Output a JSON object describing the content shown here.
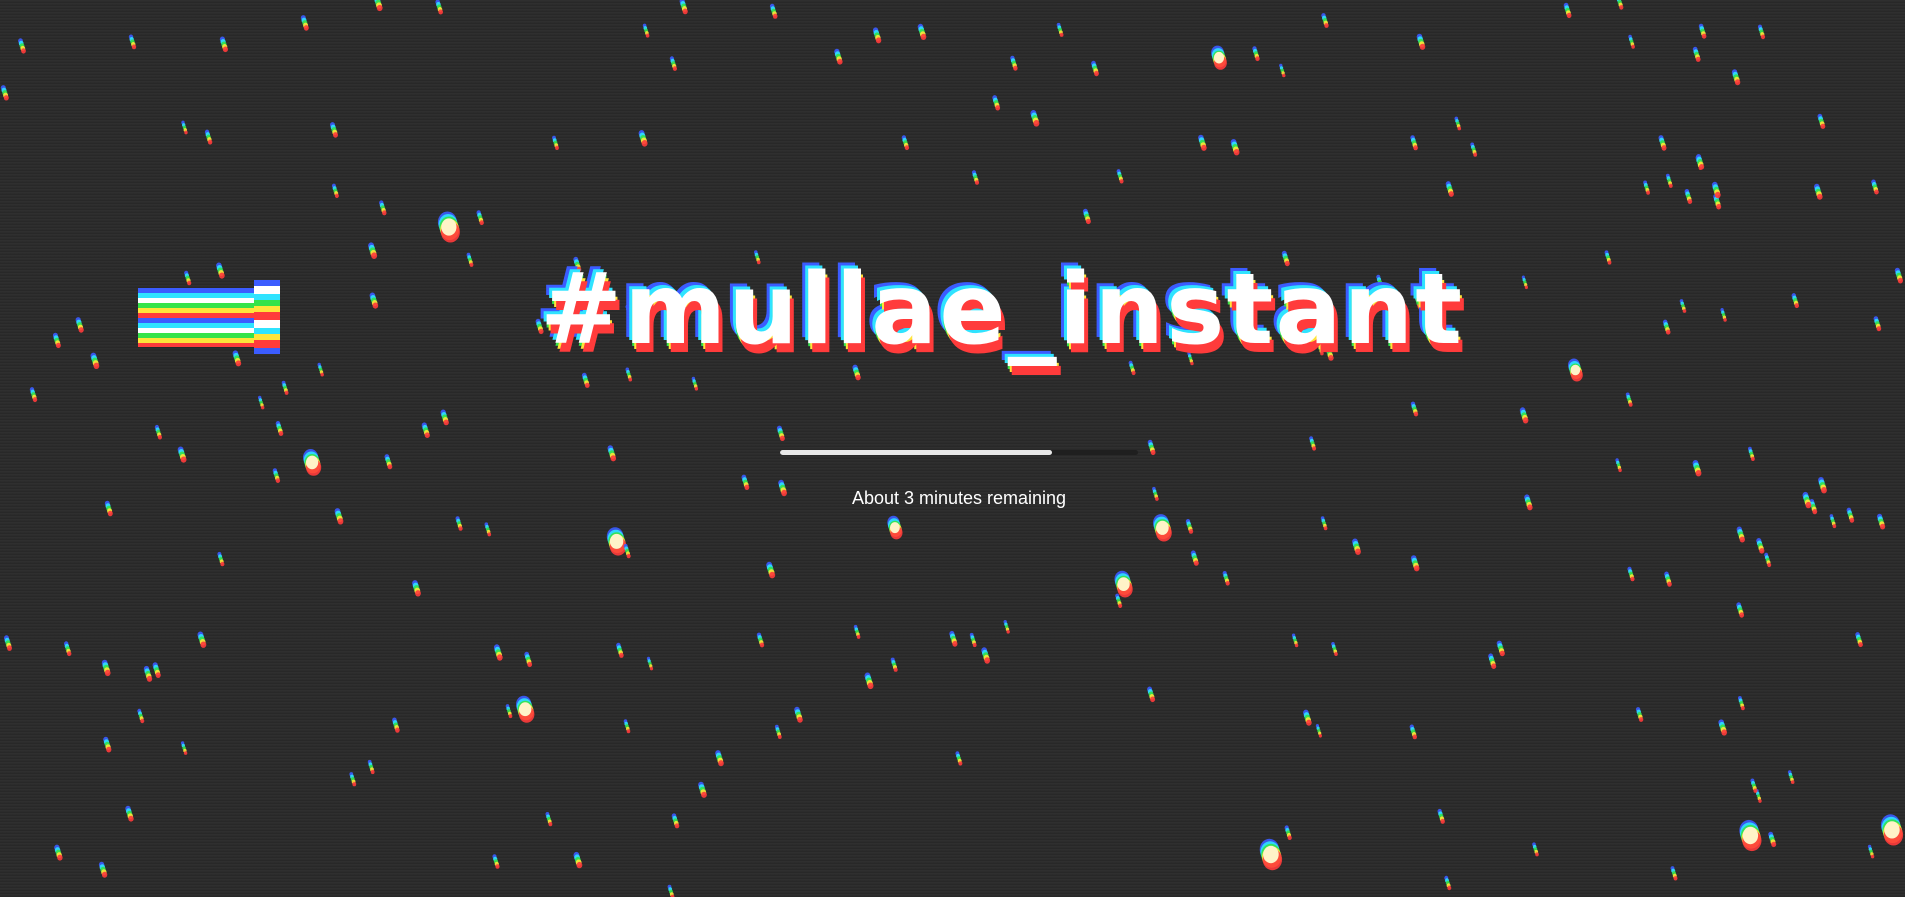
{
  "app": {
    "title": "#mullae_instant"
  },
  "loading": {
    "progress": 0.76,
    "status_text": "About 3 minutes remaining"
  },
  "theme": {
    "background": "#2a2a2a",
    "text_color": "#ffffff",
    "progress_track": "#1f1f1f",
    "progress_fill": "#e8e8e8",
    "glitch_colors": [
      "#3b5cff",
      "#2fe3ff",
      "#34e34a",
      "#ffe53a",
      "#ff3b3b"
    ]
  },
  "decorations": {
    "logo_icon": "glitch-bars-icon"
  }
}
